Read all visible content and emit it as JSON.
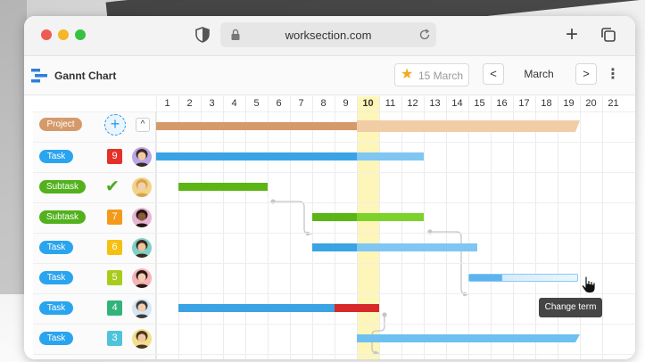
{
  "browser": {
    "url": "worksection.com"
  },
  "app": {
    "title": "Gannt Chart",
    "date_button": "15 March",
    "month": "March",
    "prev": "<",
    "next": ">",
    "more": "⋮"
  },
  "days": [
    "1",
    "2",
    "3",
    "4",
    "5",
    "6",
    "7",
    "8",
    "9",
    "10",
    "11",
    "12",
    "13",
    "14",
    "15",
    "16",
    "17",
    "18",
    "19",
    "20",
    "21"
  ],
  "today": "10",
  "project_row": {
    "label": "Project",
    "add": "+",
    "collapse": "^"
  },
  "rows": [
    {
      "type": "Task",
      "badge": "9",
      "badge_color": "#e5302a"
    },
    {
      "type": "Subtask",
      "badge": "✔",
      "badge_color": "#4aab1e"
    },
    {
      "type": "Subtask",
      "badge": "7",
      "badge_color": "#f39a1a"
    },
    {
      "type": "Task",
      "badge": "6",
      "badge_color": "#f6c012"
    },
    {
      "type": "Task",
      "badge": "5",
      "badge_color": "#a7cc1c"
    },
    {
      "type": "Task",
      "badge": "4",
      "badge_color": "#31b37b"
    },
    {
      "type": "Task",
      "badge": "3",
      "badge_color": "#4fc3d9"
    }
  ],
  "tooltip": "Change term",
  "colors": {
    "task_blue": "#3aa3e3",
    "task_light": "#7fc6f2",
    "subtask_green": "#5bb515",
    "project_brown": "#d59a6a",
    "overdue_red": "#d7282a",
    "today_yellow": "#fdf6b8"
  }
}
